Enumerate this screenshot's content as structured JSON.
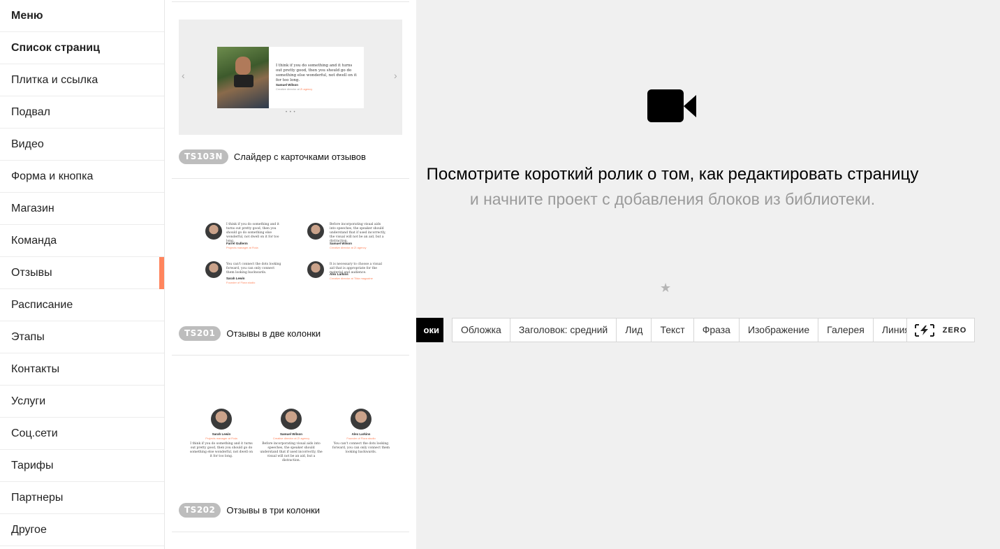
{
  "sidebar": {
    "items": [
      {
        "label": "Меню",
        "bold": true
      },
      {
        "label": "Список страниц",
        "bold": true
      },
      {
        "label": "Плитка и ссылка"
      },
      {
        "label": "Подвал"
      },
      {
        "label": "Видео"
      },
      {
        "label": "Форма и кнопка"
      },
      {
        "label": "Магазин"
      },
      {
        "label": "Команда"
      },
      {
        "label": "Отзывы",
        "active": true
      },
      {
        "label": "Расписание"
      },
      {
        "label": "Этапы"
      },
      {
        "label": "Контакты"
      },
      {
        "label": "Услуги"
      },
      {
        "label": "Соц.сети"
      },
      {
        "label": "Тарифы"
      },
      {
        "label": "Партнеры"
      },
      {
        "label": "Другое"
      }
    ],
    "accent_color": "#ff855d"
  },
  "blocks": [
    {
      "code": "TS103N",
      "title": "Слайдер с карточками отзывов",
      "preview": {
        "quote": "I think if you do something and it turns out pretty good, then you should go do something else wonderful, not dwell on it for too long.",
        "author": "Samuel Wilson",
        "role": "Creative director at ",
        "role_link": "Zi agency",
        "prev_arrow": "‹",
        "next_arrow": "›",
        "dots": "• • •"
      }
    },
    {
      "code": "TS201",
      "title": "Отзывы в две колонки",
      "preview": [
        {
          "quote": "I think if you do something and it turns out pretty good, then you should go do something else wonderful, not dwell on it for too long.",
          "name": "Farrel Gullerm",
          "role": "Projects manager at Fiola"
        },
        {
          "quote": "Before incorporating visual aids into speeches, the speaker should understand that if used incorrectly, the visual will not be an aid, but a distraction.",
          "name": "Samuel Wilson",
          "role": "Creative director at ZI agency"
        },
        {
          "quote": "You can't connect the dots looking forward, you can only connect them looking backwards.",
          "name": "Sarah Lewin",
          "role": "Founder of Flora studio"
        },
        {
          "quote": "It is necessary to choose a visual aid that is appropriate for the material and audience.",
          "name": "Alex Larkins",
          "role": "Creative director at Tilda magazine"
        }
      ]
    },
    {
      "code": "TS202",
      "title": "Отзывы в три колонки",
      "preview": [
        {
          "name": "Sarah Lewin",
          "role": "Projects manager at Fiola",
          "quote": "I think if you do something and it turns out pretty good, then you should go do something else wonderful, not dwell on it for too long."
        },
        {
          "name": "Samuel Wilson",
          "role": "Creative director at ZI agency",
          "quote": "Before incorporating visual aids into speeches, the speaker should understand that if used incorrectly, the visual will not be an aid, but a distraction."
        },
        {
          "name": "Alex Larkins",
          "role": "Founder of Flora studio",
          "quote": "You can't connect the dots looking forward, you can only connect them looking backwards."
        }
      ]
    }
  ],
  "main": {
    "video_icon": "video-camera-icon",
    "headline": "Посмотрите короткий ролик о том, как редактировать страницу",
    "subline": "и начните проект с добавления блоков из библиотеки.",
    "star": "★",
    "all_blocks_label": "оки",
    "templates": [
      "Обложка",
      "Заголовок: средний",
      "Лид",
      "Текст",
      "Фраза",
      "Изображение",
      "Галерея",
      "Линия"
    ],
    "zero_label": "ZERO"
  }
}
